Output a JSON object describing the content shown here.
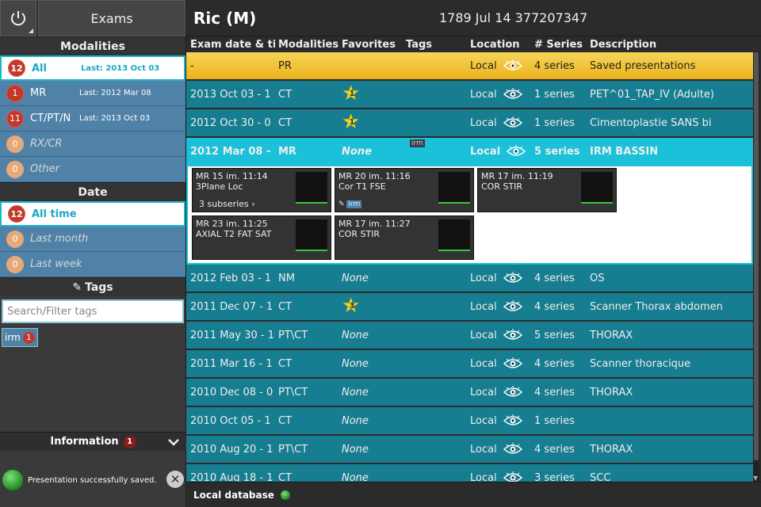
{
  "sidebar": {
    "exams_label": "Exams",
    "modalities_title": "Modalities",
    "modalities": [
      {
        "count": "12",
        "label": "All",
        "last": "Last: 2013 Oct 03"
      },
      {
        "count": "1",
        "label": "MR",
        "last": "Last: 2012 Mar 08"
      },
      {
        "count": "11",
        "label": "CT/PT/N",
        "last": "Last: 2013 Oct 03"
      },
      {
        "count": "0",
        "label": "RX/CR",
        "last": ""
      },
      {
        "count": "0",
        "label": "Other",
        "last": ""
      }
    ],
    "date_title": "Date",
    "dates": [
      {
        "count": "12",
        "label": "All time"
      },
      {
        "count": "0",
        "label": "Last month"
      },
      {
        "count": "0",
        "label": "Last week"
      }
    ],
    "tags_title": "Tags",
    "tags_search_placeholder": "Search/Filter tags",
    "tag_chip": {
      "label": "irm",
      "count": "1"
    },
    "info_title": "Information",
    "info_count": "1",
    "info_message": "Presentation successfully saved."
  },
  "patient": {
    "name": "Ric (M)",
    "details": "1789 Jul 14  377207347"
  },
  "columns": [
    "Exam date & ti",
    "Modalities",
    "Favorites",
    "Tags",
    "Location",
    "# Series",
    "Description"
  ],
  "exams": [
    {
      "date": "-",
      "mod": "PR",
      "fav": "",
      "loc": "Local",
      "series": "4 series",
      "desc": "Saved presentations"
    },
    {
      "date": "2013 Oct 03 - 1",
      "mod": "CT",
      "fav": "1",
      "loc": "Local",
      "series": "1 series",
      "desc": "PET^01_TAP_IV (Adulte)"
    },
    {
      "date": "2012 Oct 30 - 0",
      "mod": "CT",
      "fav": "1",
      "loc": "Local",
      "series": "1 series",
      "desc": "Cimentoplastie SANS bi"
    },
    {
      "date": "2012 Mar 08 - 1",
      "mod": "MR",
      "fav": "None",
      "tag": "irm",
      "loc": "Local",
      "series": "5 series",
      "desc": "IRM BASSIN"
    },
    {
      "date": "2012 Feb 03 - 1",
      "mod": "NM",
      "fav": "None",
      "loc": "Local",
      "series": "4 series",
      "desc": "OS"
    },
    {
      "date": "2011 Dec 07 - 1",
      "mod": "CT",
      "fav": "3",
      "loc": "Local",
      "series": "4 series",
      "desc": "Scanner Thorax abdomen"
    },
    {
      "date": "2011 May 30 - 1",
      "mod": "PT\\CT",
      "fav": "None",
      "loc": "Local",
      "series": "5 series",
      "desc": "THORAX"
    },
    {
      "date": "2011 Mar 16 - 1",
      "mod": "CT",
      "fav": "None",
      "loc": "Local",
      "series": "4 series",
      "desc": "Scanner thoracique"
    },
    {
      "date": "2010 Dec 08 - 0",
      "mod": "PT\\CT",
      "fav": "None",
      "loc": "Local",
      "series": "4 series",
      "desc": "THORAX"
    },
    {
      "date": "2010 Oct 05 - 1",
      "mod": "CT",
      "fav": "None",
      "loc": "Local",
      "series": "1 series",
      "desc": ""
    },
    {
      "date": "2010 Aug 20 - 1",
      "mod": "PT\\CT",
      "fav": "None",
      "loc": "Local",
      "series": "4 series",
      "desc": "THORAX"
    },
    {
      "date": "2010 Aug 18 - 1",
      "mod": "CT",
      "fav": "None",
      "loc": "Local",
      "series": "3 series",
      "desc": "SCC"
    }
  ],
  "series_cards": [
    {
      "title": "MR 15 im. 11:14",
      "desc": "3Plane Loc",
      "extra": "3 subseries"
    },
    {
      "title": "MR 20 im. 11:16",
      "desc": "Cor T1 FSE",
      "tag": "irm"
    },
    {
      "title": "MR 17 im. 11:19",
      "desc": "COR STIR"
    },
    {
      "title": "MR 23 im. 11:25",
      "desc": "AXIAL T2 FAT SAT"
    },
    {
      "title": "MR 17 im. 11:27",
      "desc": "COR STIR"
    }
  ],
  "footer": {
    "label": "Local database"
  }
}
